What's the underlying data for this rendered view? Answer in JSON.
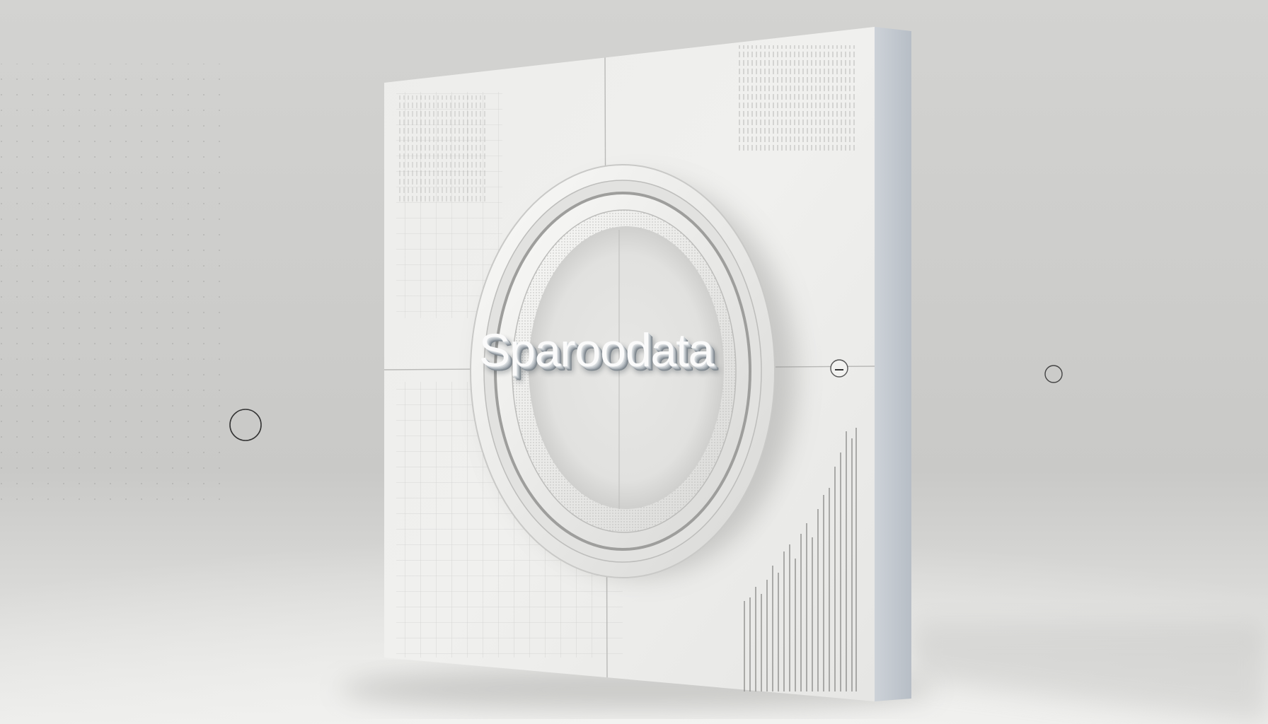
{
  "logo": {
    "text": "Sparoodata"
  },
  "colors": {
    "background": "#d6d6d4",
    "panel": "#eeeeec",
    "panel_side": "#c7ccd2",
    "ring": "#f2f2f0",
    "text": "#fbfbfb"
  }
}
